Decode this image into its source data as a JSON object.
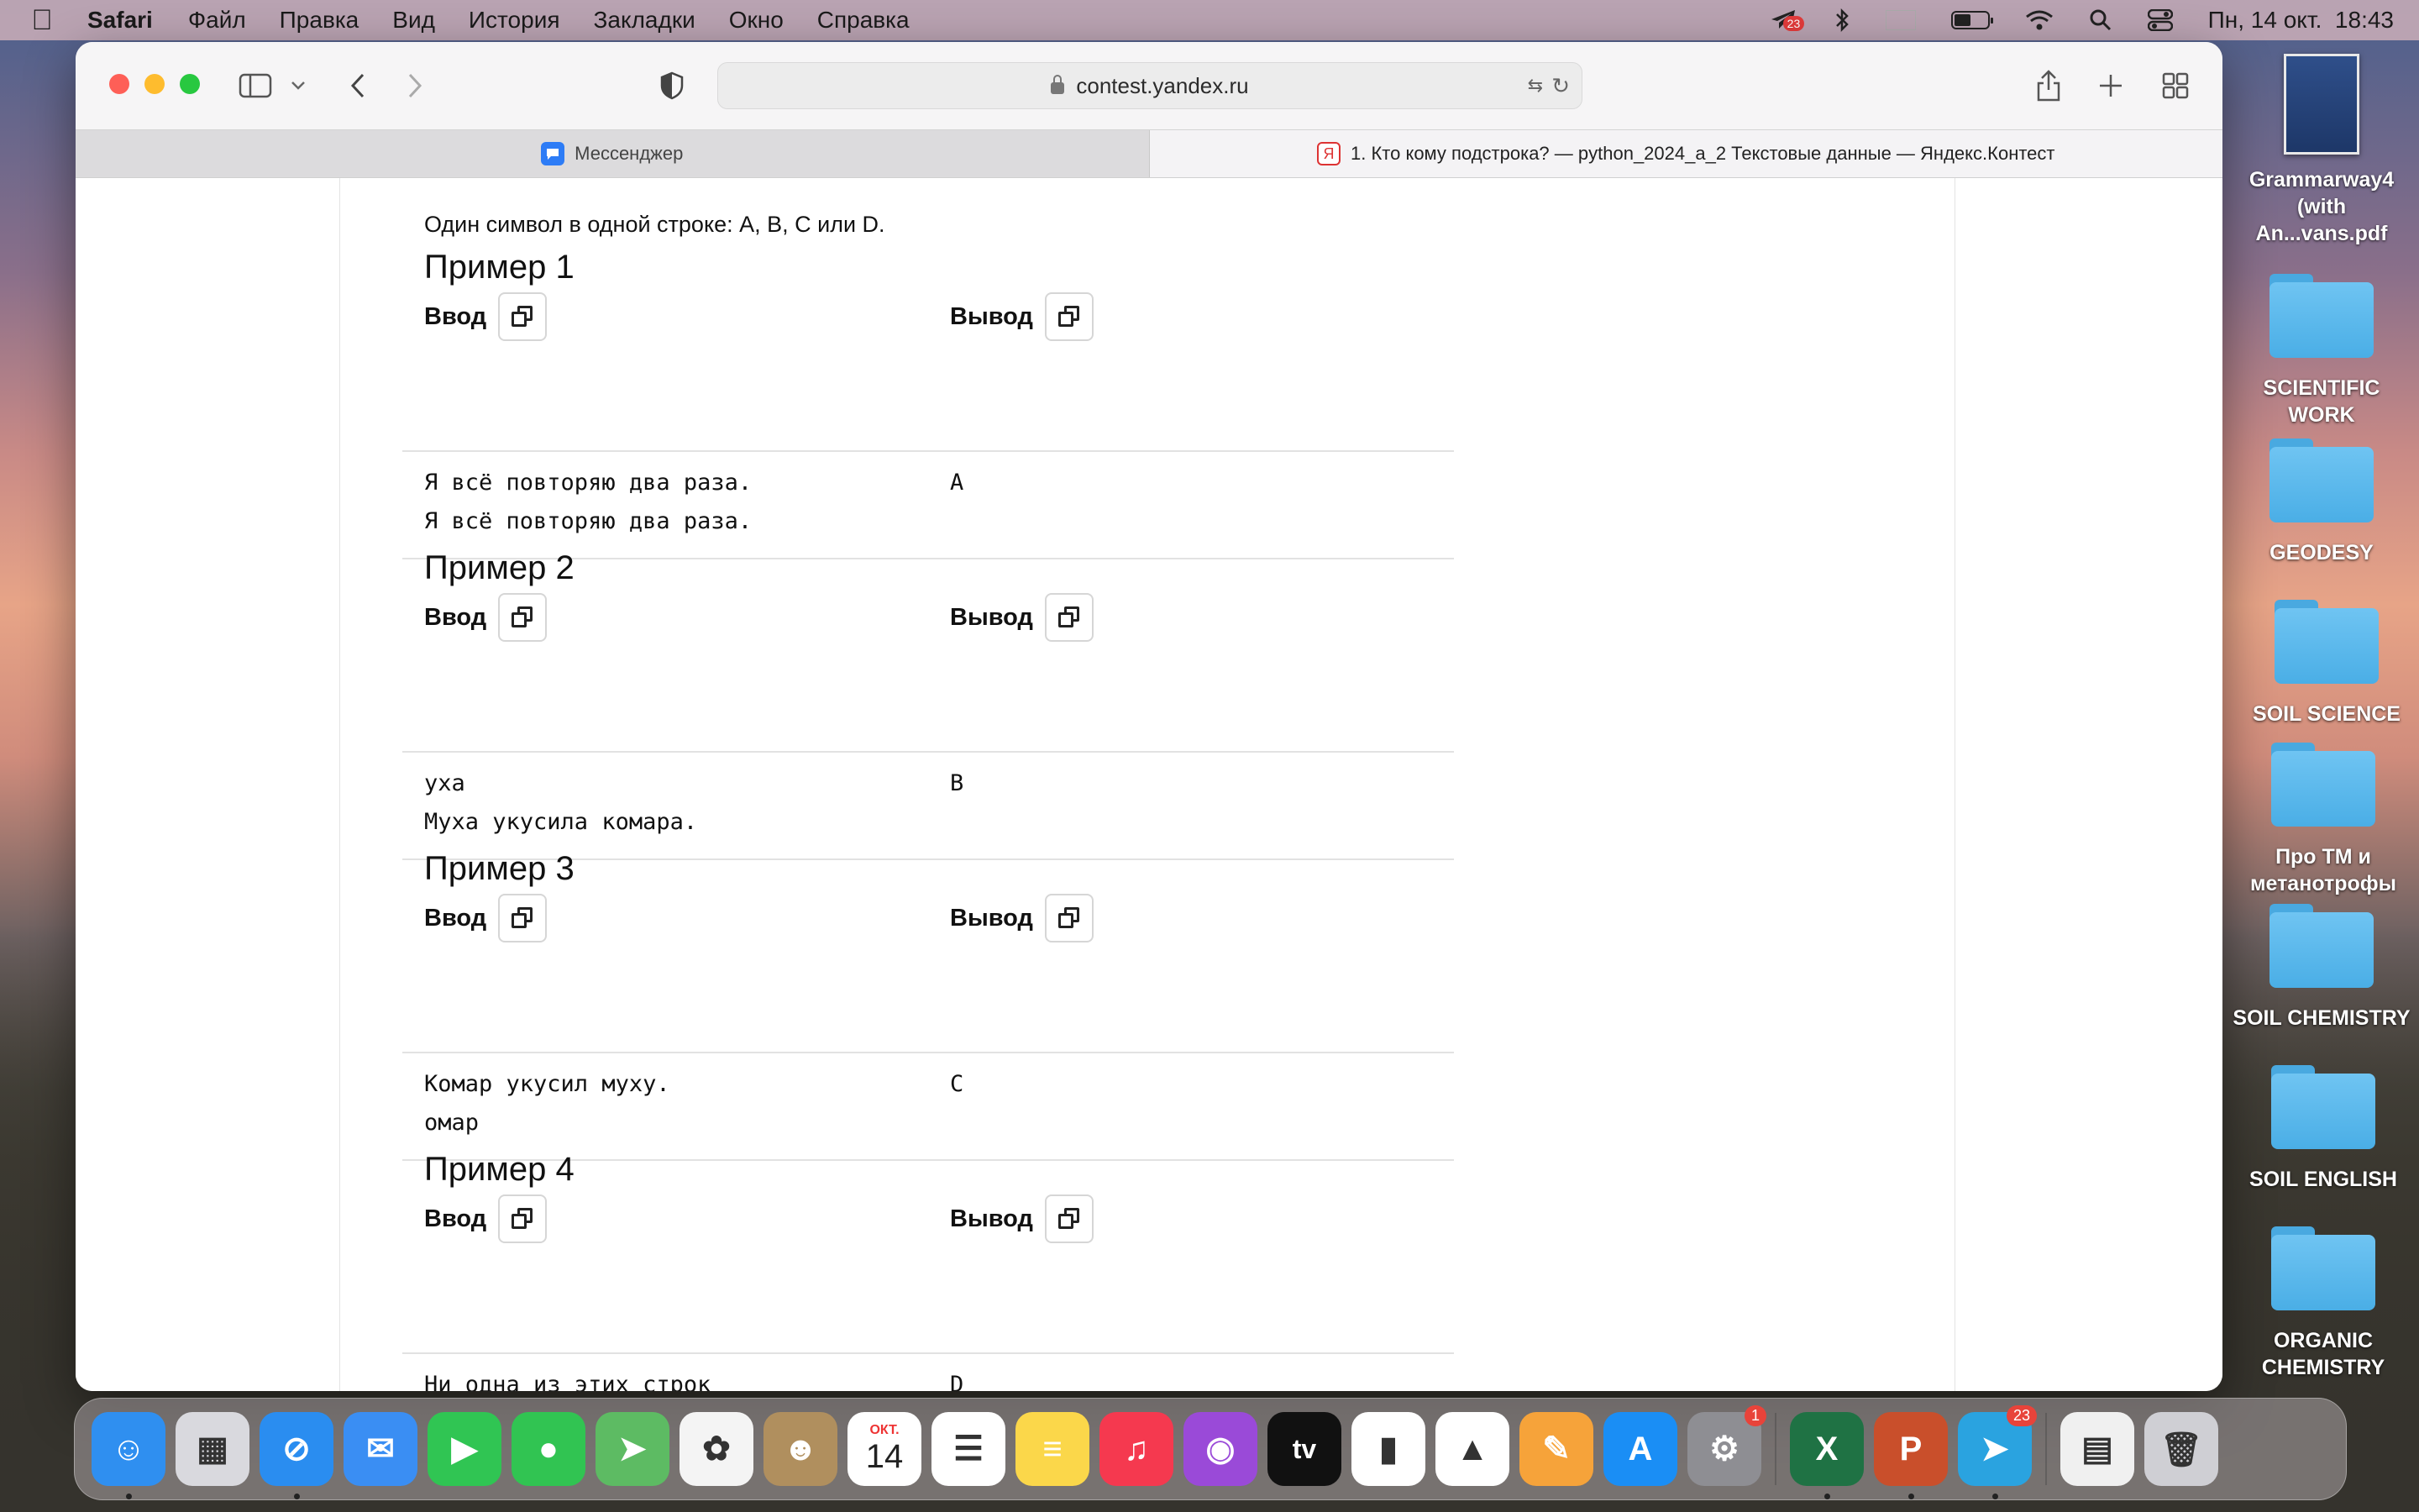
{
  "menubar": {
    "apple": "",
    "app_name": "Safari",
    "items": [
      "Файл",
      "Правка",
      "Вид",
      "История",
      "Закладки",
      "Окно",
      "Справка"
    ],
    "status_badge": "23",
    "datetime": "Пн, 14 окт.  18:43"
  },
  "browser": {
    "url": "contest.yandex.ru",
    "tabs": [
      {
        "title": "Мессенджер",
        "favicon": "messenger-icon",
        "active": false
      },
      {
        "title": "1. Кто кому подстрока? — python_2024_a_2 Текстовые данные — Яндекс.Контест",
        "favicon": "yandex-icon",
        "favicon_text": "Я",
        "active": true
      }
    ]
  },
  "page": {
    "output_format": "Один символ в одной строке: A, B, C или D.",
    "input_label": "Ввод",
    "output_label": "Вывод",
    "examples": [
      {
        "title": "Пример 1",
        "input": [
          "Я всё повторяю два раза.",
          "Я всё повторяю два раза."
        ],
        "output": "A"
      },
      {
        "title": "Пример 2",
        "input": [
          "уха",
          "Муха укусила комара."
        ],
        "output": "B"
      },
      {
        "title": "Пример 3",
        "input": [
          "Комар укусил муху.",
          "омар"
        ],
        "output": "C"
      },
      {
        "title": "Пример 4",
        "input": [
          "Ни одна из этих строк"
        ],
        "output": "D"
      }
    ]
  },
  "desktop": {
    "items": [
      {
        "label": "Grammarway4 (with An...vans.pdf",
        "type": "pdf"
      },
      {
        "label": "SCIENTIFIC WORK",
        "type": "folder"
      },
      {
        "label": "GEODESY",
        "type": "folder"
      },
      {
        "label": "SOIL SCIENCE",
        "type": "folder"
      },
      {
        "label": "Про ТМ и метанотрофы",
        "type": "folder"
      },
      {
        "label": "SOIL CHEMISTRY",
        "type": "folder"
      },
      {
        "label": "SOIL ENGLISH",
        "type": "folder"
      },
      {
        "label": "ORGANIC CHEMISTRY",
        "type": "folder"
      }
    ]
  },
  "dock": {
    "apps": [
      {
        "name": "finder",
        "color": "#2f8ff0",
        "glyph": "☺",
        "running": true
      },
      {
        "name": "launchpad",
        "color": "#d9d9de",
        "glyph": "▦",
        "running": false
      },
      {
        "name": "safari",
        "color": "#2a8df0",
        "glyph": "⊘",
        "running": true
      },
      {
        "name": "mail",
        "color": "#3a8ef3",
        "glyph": "✉",
        "running": false
      },
      {
        "name": "facetime",
        "color": "#30c553",
        "glyph": "▶",
        "running": false
      },
      {
        "name": "messages",
        "color": "#31c452",
        "glyph": "●",
        "running": false
      },
      {
        "name": "maps",
        "color": "#5dbb63",
        "glyph": "➤",
        "running": false
      },
      {
        "name": "photos",
        "color": "#f4f4f4",
        "glyph": "✿",
        "running": false
      },
      {
        "name": "contacts",
        "color": "#b08f5e",
        "glyph": "☻",
        "running": false
      },
      {
        "name": "calendar",
        "color": "#ffffff",
        "glyph": "14",
        "header": "ОКТ.",
        "running": false
      },
      {
        "name": "reminders",
        "color": "#ffffff",
        "glyph": "☰",
        "running": false
      },
      {
        "name": "notes",
        "color": "#fbd74a",
        "glyph": "≡",
        "running": false
      },
      {
        "name": "music",
        "color": "#f5394f",
        "glyph": "♫",
        "running": false
      },
      {
        "name": "podcasts",
        "color": "#9a4ad8",
        "glyph": "◉",
        "running": false
      },
      {
        "name": "apple-tv",
        "color": "#111111",
        "glyph": "tv",
        "running": false
      },
      {
        "name": "numbers",
        "color": "#ffffff",
        "glyph": "▮",
        "running": false
      },
      {
        "name": "keynote",
        "color": "#ffffff",
        "glyph": "▲",
        "running": false
      },
      {
        "name": "pages",
        "color": "#f6a33a",
        "glyph": "✎",
        "running": false
      },
      {
        "name": "app-store",
        "color": "#1a8ef5",
        "glyph": "A",
        "running": false
      },
      {
        "name": "system-settings",
        "color": "#8e8e93",
        "glyph": "⚙",
        "badge": "1",
        "running": false
      },
      {
        "name": "excel",
        "color": "#1f7244",
        "glyph": "X",
        "running": true
      },
      {
        "name": "powerpoint",
        "color": "#c94f2b",
        "glyph": "P",
        "running": true
      },
      {
        "name": "telegram",
        "color": "#2aa3e0",
        "glyph": "➤",
        "badge": "23",
        "running": true
      },
      {
        "name": "preview-document",
        "color": "#f0f0f0",
        "glyph": "▤",
        "running": false
      },
      {
        "name": "trash",
        "color": "#cfcfd4",
        "glyph": "🗑",
        "running": false
      }
    ]
  }
}
